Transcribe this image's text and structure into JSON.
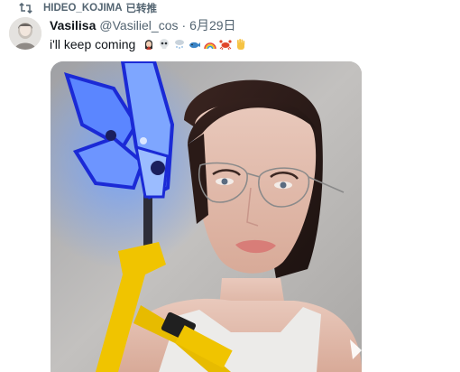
{
  "repost": {
    "icon": "repost-icon",
    "reposter": "HIDEO_KOJIMA",
    "action": "已转推"
  },
  "author": {
    "display_name": "Vasilisa",
    "handle": "@Vasiliel_cos",
    "separator": "·",
    "date": "6月29日"
  },
  "tweet": {
    "text": "i'll keep coming",
    "emojis": [
      "vampire-emoji",
      "skull-emoji",
      "snow-cloud-emoji",
      "whale-emoji",
      "rainbow-emoji",
      "crab-emoji",
      "raised-hand-emoji"
    ]
  },
  "media": {
    "type": "photo",
    "subject": "cosplayer with glasses and glowing blue prop"
  },
  "colors": {
    "secondary_text": "#536471",
    "primary_text": "#0f1419",
    "neon_blue": "#4a7dff",
    "strap_yellow": "#f0c400"
  }
}
